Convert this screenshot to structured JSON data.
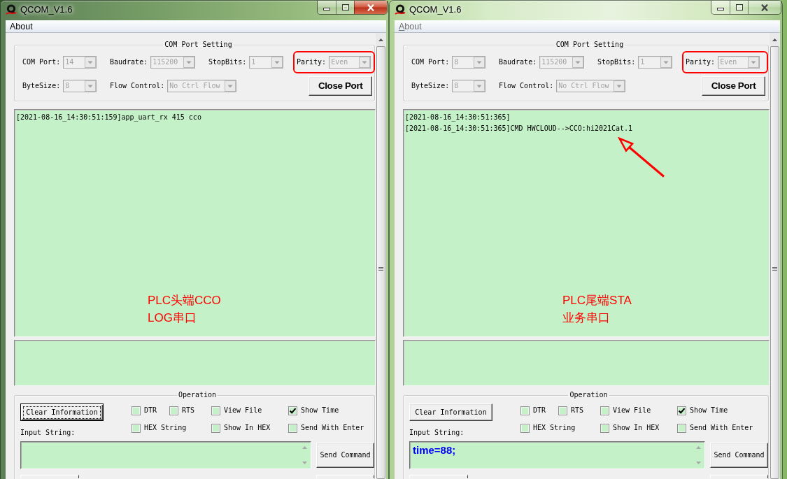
{
  "windows": [
    {
      "title": "QCOM_V1.6",
      "active": true,
      "menu": [
        {
          "label": "About",
          "disabled": false,
          "mnemonic_shown": false
        }
      ],
      "port_setting": {
        "title": "COM Port Setting",
        "rows": [
          [
            {
              "label": "COM Port:",
              "value": "14",
              "disabled": true,
              "annotated": false
            },
            {
              "label": "Baudrate:",
              "value": "115200",
              "disabled": true,
              "annotated": false
            },
            {
              "label": "StopBits:",
              "value": "1",
              "disabled": true,
              "annotated": false
            },
            {
              "label": "Parity:",
              "value": "Even",
              "disabled": true,
              "annotated": true
            }
          ],
          [
            {
              "label": "ByteSize:",
              "value": "8",
              "disabled": true,
              "annotated": false
            },
            {
              "label": "Flow Control:",
              "value": "No Ctrl Flow",
              "disabled": true,
              "annotated": false
            }
          ]
        ],
        "button": "Close Port"
      },
      "log": {
        "lines": [
          "[2021-08-16_14:30:51:159]app_uart_rx 415 cco"
        ],
        "note": [
          "PLC头端CCO",
          "LOG串口"
        ]
      },
      "operation": {
        "title": "Operation",
        "clear_button": {
          "label": "Clear Information",
          "focused": true
        },
        "options": [
          [
            {
              "label": "DTR",
              "checked": false
            },
            {
              "label": "RTS",
              "checked": false
            },
            {
              "label": "View File",
              "checked": false
            },
            {
              "label": "Show Time",
              "checked": true
            }
          ],
          [
            {
              "label": "HEX String",
              "checked": false
            },
            {
              "label": "Show In HEX",
              "checked": false
            },
            {
              "label": "Send With Enter",
              "checked": false
            }
          ]
        ],
        "input_label": "Input String:",
        "send_button": "Send Command"
      }
    },
    {
      "title": "QCOM_V1.6",
      "active": false,
      "menu": [
        {
          "label": "About",
          "disabled": true,
          "mnemonic_shown": true
        }
      ],
      "port_setting": {
        "title": "COM Port Setting",
        "rows": [
          [
            {
              "label": "COM Port:",
              "value": "8",
              "disabled": true,
              "annotated": false
            },
            {
              "label": "Baudrate:",
              "value": "115200",
              "disabled": true,
              "annotated": false
            },
            {
              "label": "StopBits:",
              "value": "1",
              "disabled": true,
              "annotated": false
            },
            {
              "label": "Parity:",
              "value": "Even",
              "disabled": true,
              "annotated": true
            }
          ],
          [
            {
              "label": "ByteSize:",
              "value": "8",
              "disabled": true,
              "annotated": false
            },
            {
              "label": "Flow Control:",
              "value": "No Ctrl Flow",
              "disabled": true,
              "annotated": false
            }
          ]
        ],
        "button": "Close Port"
      },
      "log": {
        "lines": [
          "[2021-08-16_14:30:51:365]",
          "[2021-08-16_14:30:51:365]CMD HWCLOUD-->CCO:hi2021Cat.1"
        ],
        "note": [
          "PLC尾端STA",
          "业务串口"
        ],
        "arrow": true
      },
      "operation": {
        "title": "Operation",
        "clear_button": {
          "label": "Clear Information",
          "focused": false
        },
        "options": [
          [
            {
              "label": "DTR",
              "checked": false
            },
            {
              "label": "RTS",
              "checked": false
            },
            {
              "label": "View File",
              "checked": false
            },
            {
              "label": "Show Time",
              "checked": true
            }
          ],
          [
            {
              "label": "HEX String",
              "checked": false
            },
            {
              "label": "Show In HEX",
              "checked": false
            },
            {
              "label": "Send With Enter",
              "checked": false
            }
          ]
        ],
        "input_label": "Input String:",
        "input_value": "time=88;",
        "send_button": "Send Command"
      }
    }
  ]
}
